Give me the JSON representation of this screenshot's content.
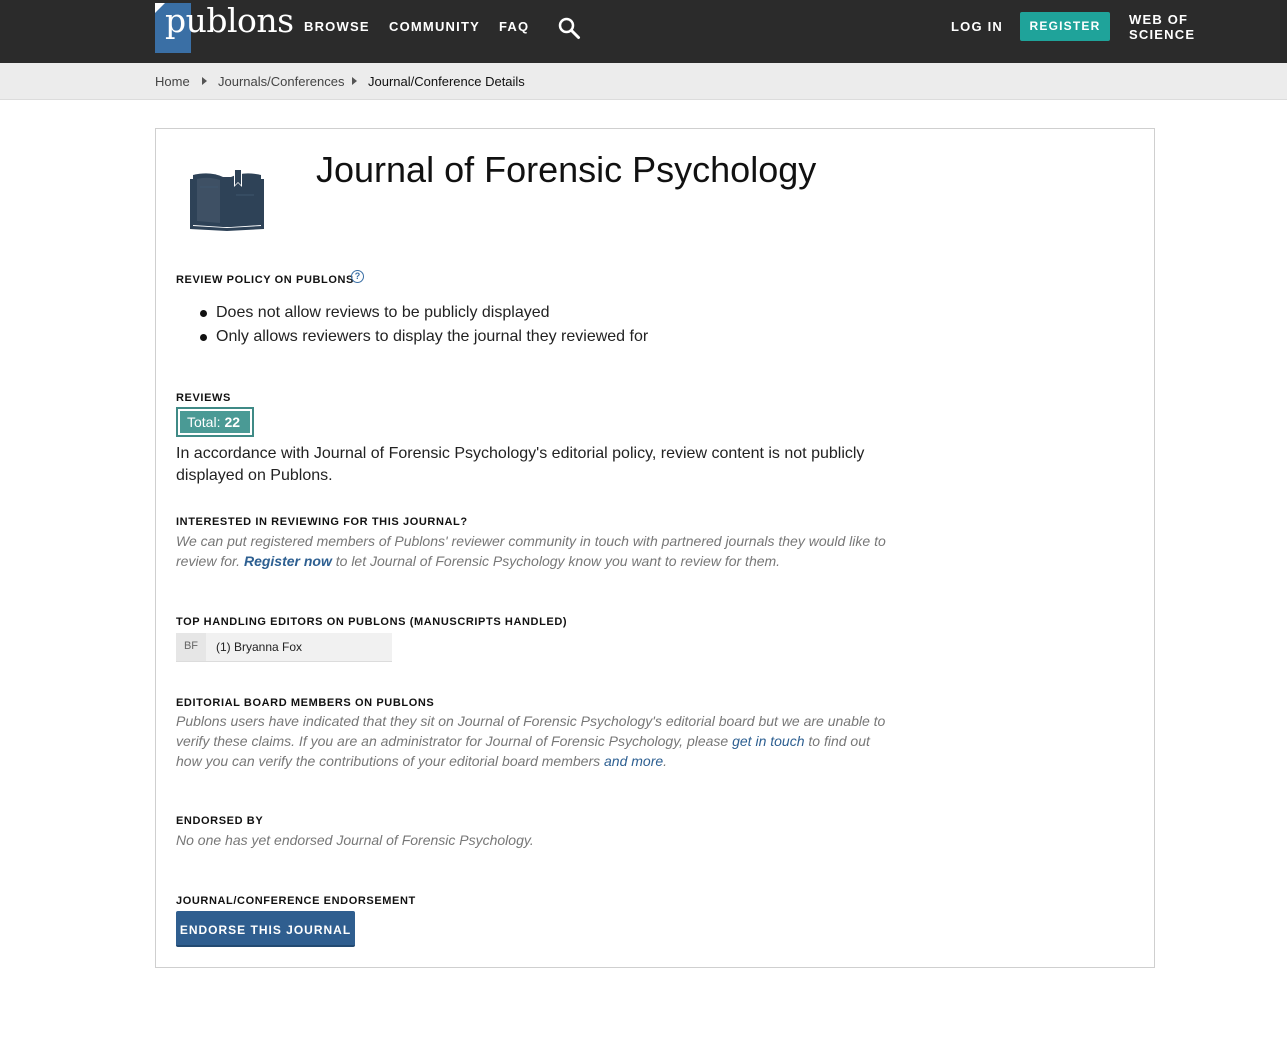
{
  "nav": {
    "logo_text": "publons",
    "browse": "BROWSE",
    "community": "COMMUNITY",
    "faq": "FAQ",
    "login": "LOG IN",
    "register": "REGISTER",
    "wos_line1": "WEB OF",
    "wos_line2": "SCIENCE"
  },
  "breadcrumb": {
    "home": "Home",
    "journals": "Journals/Conferences",
    "current": "Journal/Conference Details"
  },
  "journal": {
    "title": "Journal of Forensic Psychology"
  },
  "review_policy": {
    "label": "REVIEW POLICY ON PUBLONS",
    "help_glyph": "?",
    "items": [
      "Does not allow reviews to be publicly displayed",
      "Only allows reviewers to display the journal they reviewed for"
    ]
  },
  "reviews": {
    "label": "REVIEWS",
    "total_label": "Total:",
    "total_value": "22",
    "note": "In accordance with Journal of Forensic Psychology's editorial policy, review content is not publicly displayed on Publons."
  },
  "interested": {
    "label": "INTERESTED IN REVIEWING FOR THIS JOURNAL?",
    "text_before": "We can put registered members of Publons' reviewer community in touch with partnered journals they would like to review for. ",
    "link": "Register now",
    "text_after": " to let Journal of Forensic Psychology know you want to review for them."
  },
  "editors": {
    "label": "TOP HANDLING EDITORS ON PUBLONS (MANUSCRIPTS HANDLED)",
    "items": [
      {
        "initials": "BF",
        "name": "(1) Bryanna Fox"
      }
    ]
  },
  "board": {
    "label": "EDITORIAL BOARD MEMBERS ON PUBLONS",
    "text_before": "Publons users have indicated that they sit on Journal of Forensic Psychology's editorial board but we are unable to verify these claims. If you are an administrator for Journal of Forensic Psychology, please ",
    "link1": "get in touch",
    "text_middle": " to find out how you can verify the contributions of your editorial board members ",
    "link2": "and more",
    "text_after": "."
  },
  "endorsed": {
    "label": "ENDORSED BY",
    "text": "No one has yet endorsed Journal of Forensic Psychology."
  },
  "endorsement": {
    "label": "JOURNAL/CONFERENCE ENDORSEMENT",
    "button": "ENDORSE THIS JOURNAL"
  },
  "colors": {
    "topbar": "#2b2b2b",
    "accent_teal": "#1fa39a",
    "brand_blue": "#3a6fa5",
    "button_blue": "#2f5e8f"
  }
}
